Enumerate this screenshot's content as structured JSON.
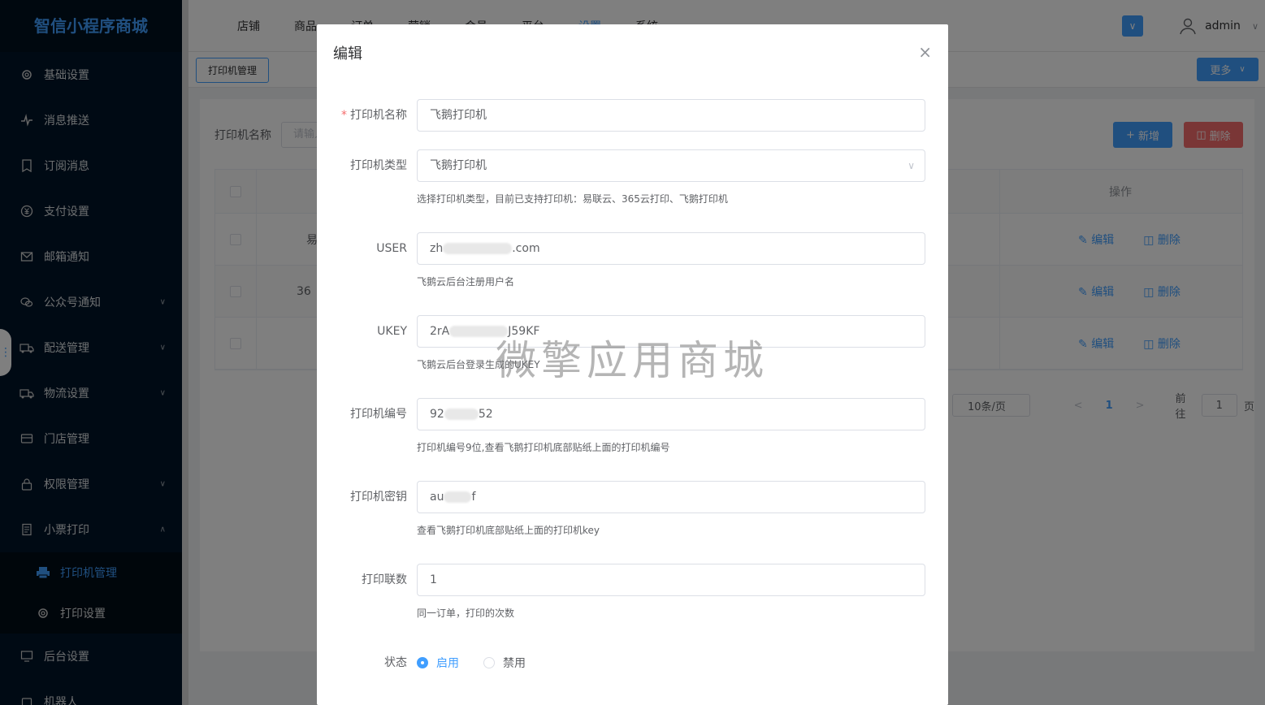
{
  "app": {
    "brand": "智信小程序商城"
  },
  "sidebar": {
    "items": [
      {
        "label": "基础设置",
        "icon": "gear-icon",
        "expandable": false
      },
      {
        "label": "消息推送",
        "icon": "pulse-icon",
        "expandable": false
      },
      {
        "label": "订阅消息",
        "icon": "bookmark-icon",
        "expandable": false
      },
      {
        "label": "支付设置",
        "icon": "yen-icon",
        "expandable": false
      },
      {
        "label": "邮箱通知",
        "icon": "mail-icon",
        "expandable": false
      },
      {
        "label": "公众号通知",
        "icon": "wechat-icon",
        "expandable": true
      },
      {
        "label": "配送管理",
        "icon": "truck-icon",
        "expandable": true
      },
      {
        "label": "物流设置",
        "icon": "truck-icon",
        "expandable": true
      },
      {
        "label": "门店管理",
        "icon": "store-icon",
        "expandable": false
      },
      {
        "label": "权限管理",
        "icon": "lock-icon",
        "expandable": true
      },
      {
        "label": "小票打印",
        "icon": "receipt-icon",
        "expandable": true,
        "expanded": true
      }
    ],
    "subitems": [
      {
        "label": "打印机管理",
        "icon": "printer-icon",
        "active": true
      },
      {
        "label": "打印设置",
        "icon": "gear-icon",
        "active": false
      }
    ],
    "bottom_items": [
      {
        "label": "后台设置",
        "icon": "monitor-icon"
      },
      {
        "label": "机器人",
        "icon": "robot-icon"
      }
    ]
  },
  "header": {
    "nav": [
      "店铺",
      "商品",
      "订单",
      "营销",
      "会员",
      "平台",
      "设置",
      "系统"
    ],
    "active_nav": "设置",
    "user": "admin"
  },
  "tabs": {
    "current": "打印机管理",
    "more": "更多"
  },
  "list": {
    "filter_label": "打印机名称",
    "filter_placeholder": "请输入",
    "add_button": "新增",
    "delete_button": "删除",
    "op_header": "操作",
    "rows": [
      {
        "name": "易",
        "edit": "编辑",
        "delete": "删除"
      },
      {
        "name": "36",
        "edit": "编辑",
        "delete": "删除"
      },
      {
        "name": "",
        "edit": "编辑",
        "delete": "删除"
      }
    ],
    "pager": {
      "page_size": "10条/页",
      "current_page": "1",
      "goto_label": "前往",
      "goto_value": "1",
      "page_suffix": "页"
    }
  },
  "dialog": {
    "title": "编辑",
    "fields": {
      "name": {
        "label": "打印机名称",
        "value": "飞鹅打印机",
        "required": true
      },
      "type": {
        "label": "打印机类型",
        "value": "飞鹅打印机",
        "hint": "选择打印机类型，目前已支持打印机：易联云、365云打印、飞鹅打印机"
      },
      "user": {
        "label": "USER",
        "value_prefix": "zh",
        "value_suffix": ".com",
        "hint": "飞鹅云后台注册用户名"
      },
      "ukey": {
        "label": "UKEY",
        "value_prefix": "2rA",
        "value_suffix": "J59KF",
        "hint": "飞鹅云后台登录生成的UKEY"
      },
      "sn": {
        "label": "打印机编号",
        "value_prefix": "92",
        "value_suffix": "52",
        "hint": "打印机编号9位,查看飞鹅打印机底部贴纸上面的打印机编号"
      },
      "key": {
        "label": "打印机密钥",
        "value_prefix": "au",
        "value_suffix": "f",
        "hint": "查看飞鹅打印机底部贴纸上面的打印机key"
      },
      "copies": {
        "label": "打印联数",
        "value": "1",
        "hint": "同一订单，打印的次数"
      },
      "status": {
        "label": "状态",
        "options": [
          "启用",
          "禁用"
        ],
        "selected": "启用"
      }
    }
  },
  "watermark": "微擎应用商城",
  "colors": {
    "primary": "#409eff",
    "danger": "#f56c6c",
    "sidebar_bg": "#001529"
  }
}
